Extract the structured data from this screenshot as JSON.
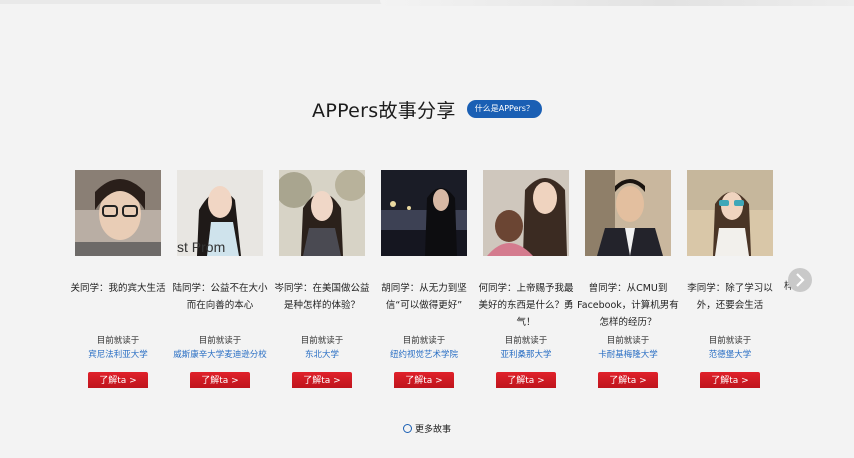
{
  "header": {
    "title": "APPers故事分享",
    "what_button": "什么是APPers？"
  },
  "cards": [
    {
      "quote": "关同学：我的宾大生活",
      "school_label": "目前就读于",
      "school": "宾尼法利亚大学",
      "button": "了解ta >"
    },
    {
      "quote": "陆同学：公益不在大小而在向善的本心",
      "school_label": "目前就读于",
      "school": "威斯康辛大学麦迪逊分校",
      "button": "了解ta >"
    },
    {
      "quote": "岑同学：在美国做公益是种怎样的体验？",
      "school_label": "目前就读于",
      "school": "东北大学",
      "button": "了解ta >"
    },
    {
      "quote": "胡同学：从无力到坚信“可以做得更好”",
      "school_label": "目前就读于",
      "school": "纽约视觉艺术学院",
      "button": "了解ta >"
    },
    {
      "quote": "何同学：上帝赐予我最美好的东西是什么？勇气！",
      "school_label": "目前就读于",
      "school": "亚利桑那大学",
      "button": "了解ta >"
    },
    {
      "quote": "曾同学：从CMU到Facebook，计算机男有怎样的经历？",
      "school_label": "目前就读于",
      "school": "卡耐基梅隆大学",
      "button": "了解ta >"
    },
    {
      "quote": "李同学：除了学习以外，还要会生活",
      "school_label": "目前就读于",
      "school": "范德堡大学",
      "button": "了解ta >"
    }
  ],
  "partial_next_char": "梓",
  "photo_overlay_text": "st Prom",
  "more_stories": "更多故事",
  "colors": {
    "accent_blue": "#1a5fb4",
    "button_red": "#d01820",
    "link_blue": "#2a6fc4"
  },
  "icons": {
    "next": "chevron-right-icon",
    "more": "circle-icon"
  }
}
